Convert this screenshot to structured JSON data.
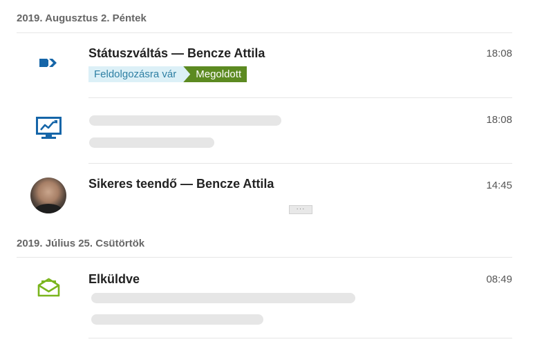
{
  "groups": [
    {
      "date": "2019. Augusztus 2. Péntek",
      "items": [
        {
          "icon": "status-change-icon",
          "title": "Státuszváltás — Bencze Attila",
          "time": "18:08",
          "status_from": "Feldolgozásra vár",
          "status_to": "Megoldott"
        },
        {
          "icon": "monitor-chart-icon",
          "title": "",
          "time": "18:08"
        },
        {
          "icon": "avatar",
          "title": "Sikeres teendő — Bencze Attila",
          "time": "14:45",
          "expand_label": "···"
        }
      ]
    },
    {
      "date": "2019. Július 25. Csütörtök",
      "items": [
        {
          "icon": "open-envelope-icon",
          "title": "Elküldve",
          "time": "08:49"
        }
      ]
    }
  ],
  "colors": {
    "accent_blue": "#1565a8",
    "accent_green": "#7ab51d",
    "status_from_bg": "#dcf0f7",
    "status_to_bg": "#5c8a21",
    "placeholder": "#e6e6e6"
  }
}
